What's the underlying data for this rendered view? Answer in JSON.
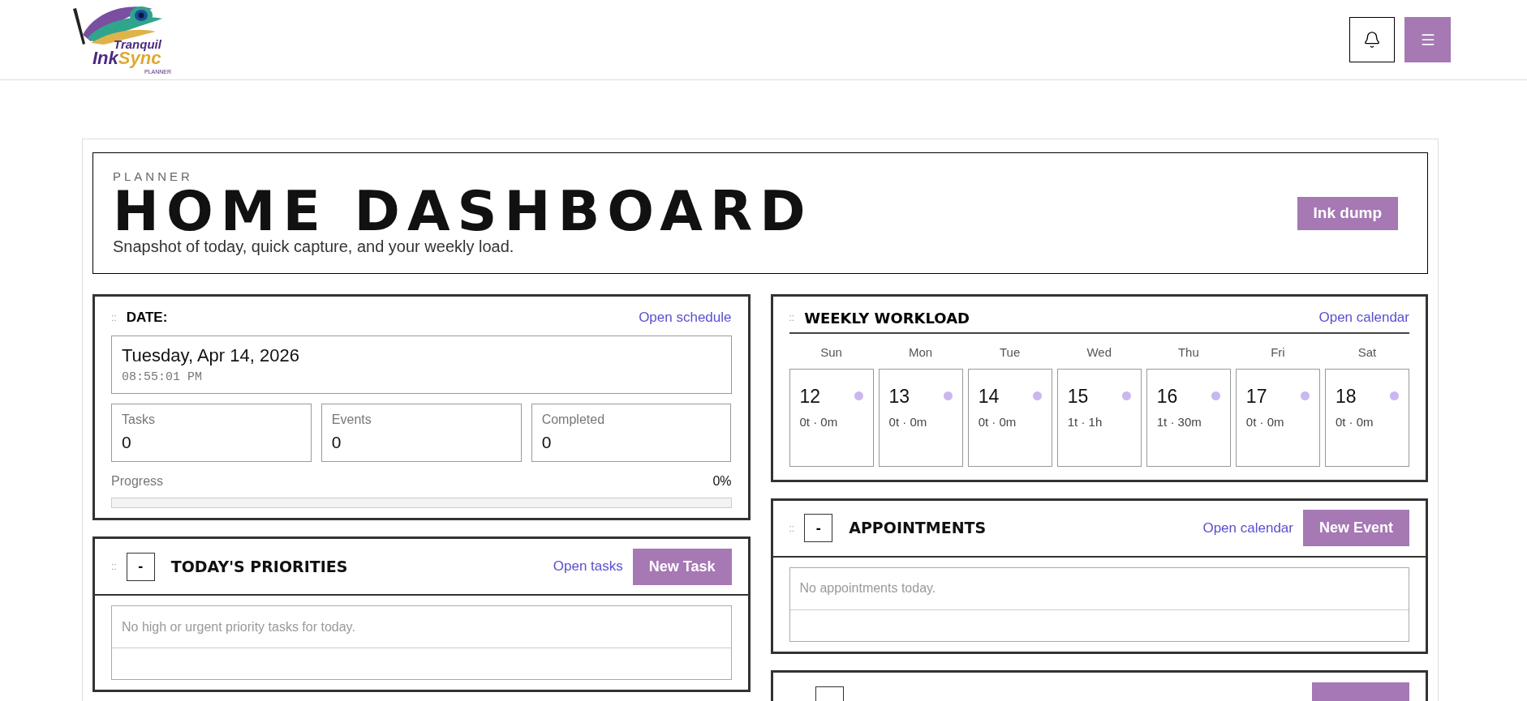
{
  "logo": {
    "line1": "Tranquil",
    "line2a": "Ink",
    "line2b": "Sync",
    "line3": "PLANNER"
  },
  "hero": {
    "eyebrow": "PLANNER",
    "title": "HOME DASHBOARD",
    "subtitle": "Snapshot of today, quick capture, and your weekly load.",
    "button": "Ink dump"
  },
  "date_card": {
    "handle": "::",
    "title": "DATE:",
    "link": "Open schedule",
    "date": "Tuesday, Apr 14, 2026",
    "time": "08:55:01 PM",
    "stats": [
      {
        "label": "Tasks",
        "value": "0"
      },
      {
        "label": "Events",
        "value": "0"
      },
      {
        "label": "Completed",
        "value": "0"
      }
    ],
    "progress": {
      "label": "Progress",
      "reading": "0%",
      "level": 0
    }
  },
  "priorities": {
    "handle": "::",
    "collapse": "-",
    "title": "TODAY'S PRIORITIES",
    "link": "Open tasks",
    "button": "New Task",
    "empty": "No high or urgent priority tasks for today."
  },
  "weekly": {
    "handle": "::",
    "title": "WEEKLY WORKLOAD",
    "link": "Open calendar",
    "days": [
      {
        "weekday": "Sun",
        "date": "12",
        "load": "0t · 0m",
        "color": "#c9b8f0"
      },
      {
        "weekday": "Mon",
        "date": "13",
        "load": "0t · 0m",
        "color": "#c9b8f0"
      },
      {
        "weekday": "Tue",
        "date": "14",
        "load": "0t · 0m",
        "color": "#c9b8f0"
      },
      {
        "weekday": "Wed",
        "date": "15",
        "load": "1t · 1h",
        "color": "#c9b8f0"
      },
      {
        "weekday": "Thu",
        "date": "16",
        "load": "1t · 30m",
        "color": "#c9b8f0"
      },
      {
        "weekday": "Fri",
        "date": "17",
        "load": "0t · 0m",
        "color": "#c9b8f0"
      },
      {
        "weekday": "Sat",
        "date": "18",
        "load": "0t · 0m",
        "color": "#c9b8f0"
      }
    ]
  },
  "appointments": {
    "handle": "::",
    "collapse": "-",
    "title": "APPOINTMENTS",
    "link": "Open calendar",
    "button": "New Event",
    "empty": "No appointments today."
  }
}
